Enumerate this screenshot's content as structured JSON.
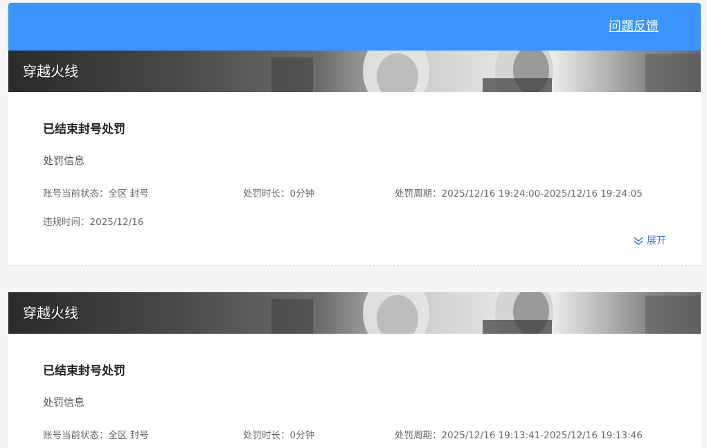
{
  "header": {
    "feedback_label": "问题反馈"
  },
  "icons": {
    "expand": "double-chevron-down-icon"
  },
  "colors": {
    "header_bg": "#3a94fb",
    "link_blue": "#3a7bd5"
  },
  "records": [
    {
      "game": "穿越火线",
      "status_title": "已结束封号处罚",
      "section_label": "处罚信息",
      "account_status": "账号当前状态：全区 封号",
      "duration": "处罚时长：0分钟",
      "period": "处罚周期：2025/12/16 19:24:00-2025/12/16 19:24:05",
      "violation_time": "违规时间：2025/12/16",
      "expand_label": "展开"
    },
    {
      "game": "穿越火线",
      "status_title": "已结束封号处罚",
      "section_label": "处罚信息",
      "account_status": "账号当前状态：全区 封号",
      "duration": "处罚时长：0分钟",
      "period": "处罚周期：2025/12/16 19:13:41-2025/12/16 19:13:46"
    }
  ]
}
